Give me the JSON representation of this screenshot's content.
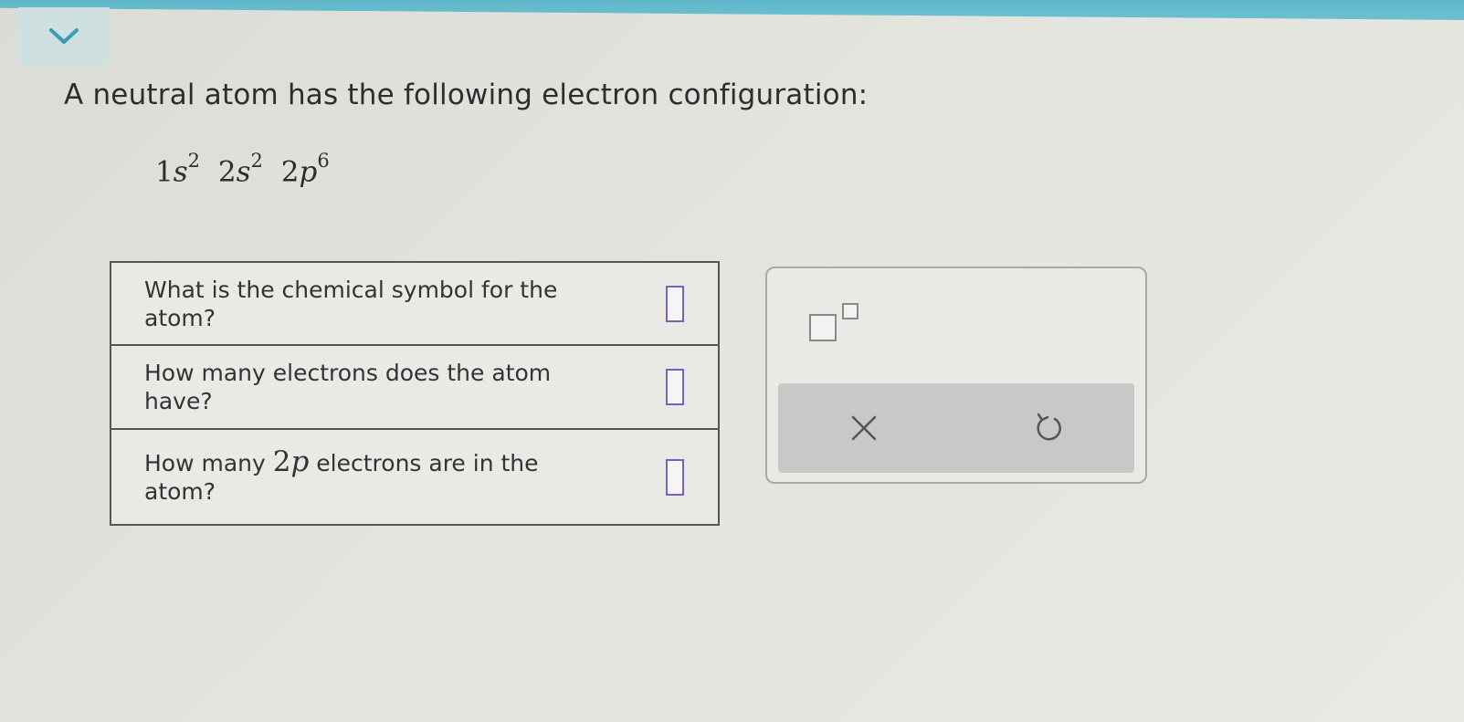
{
  "header": {
    "collapse_icon": "chevron-down-icon",
    "bar_color": "#62b9cb"
  },
  "question": {
    "text": "A neutral atom has the following electron configuration:"
  },
  "configuration": {
    "terms": [
      {
        "coef": "1",
        "orbital": "s",
        "exp": "2"
      },
      {
        "coef": "2",
        "orbital": "s",
        "exp": "2"
      },
      {
        "coef": "2",
        "orbital": "p",
        "exp": "6"
      }
    ]
  },
  "table": {
    "rows": [
      {
        "label": "What is the chemical symbol for the atom?",
        "value": ""
      },
      {
        "label_pre": "How many electrons does the atom have?",
        "value": ""
      },
      {
        "label_pre": "How many ",
        "math_coef": "2",
        "math_var": "p",
        "label_post": " electrons are in the atom?",
        "value": ""
      }
    ]
  },
  "toolbar": {
    "superscript_icon": "superscript-icon",
    "clear_icon": "close-icon",
    "undo_icon": "undo-icon"
  },
  "colors": {
    "answer_box_border": "#7a5ec0",
    "action_bar": "#c8c8c6"
  }
}
